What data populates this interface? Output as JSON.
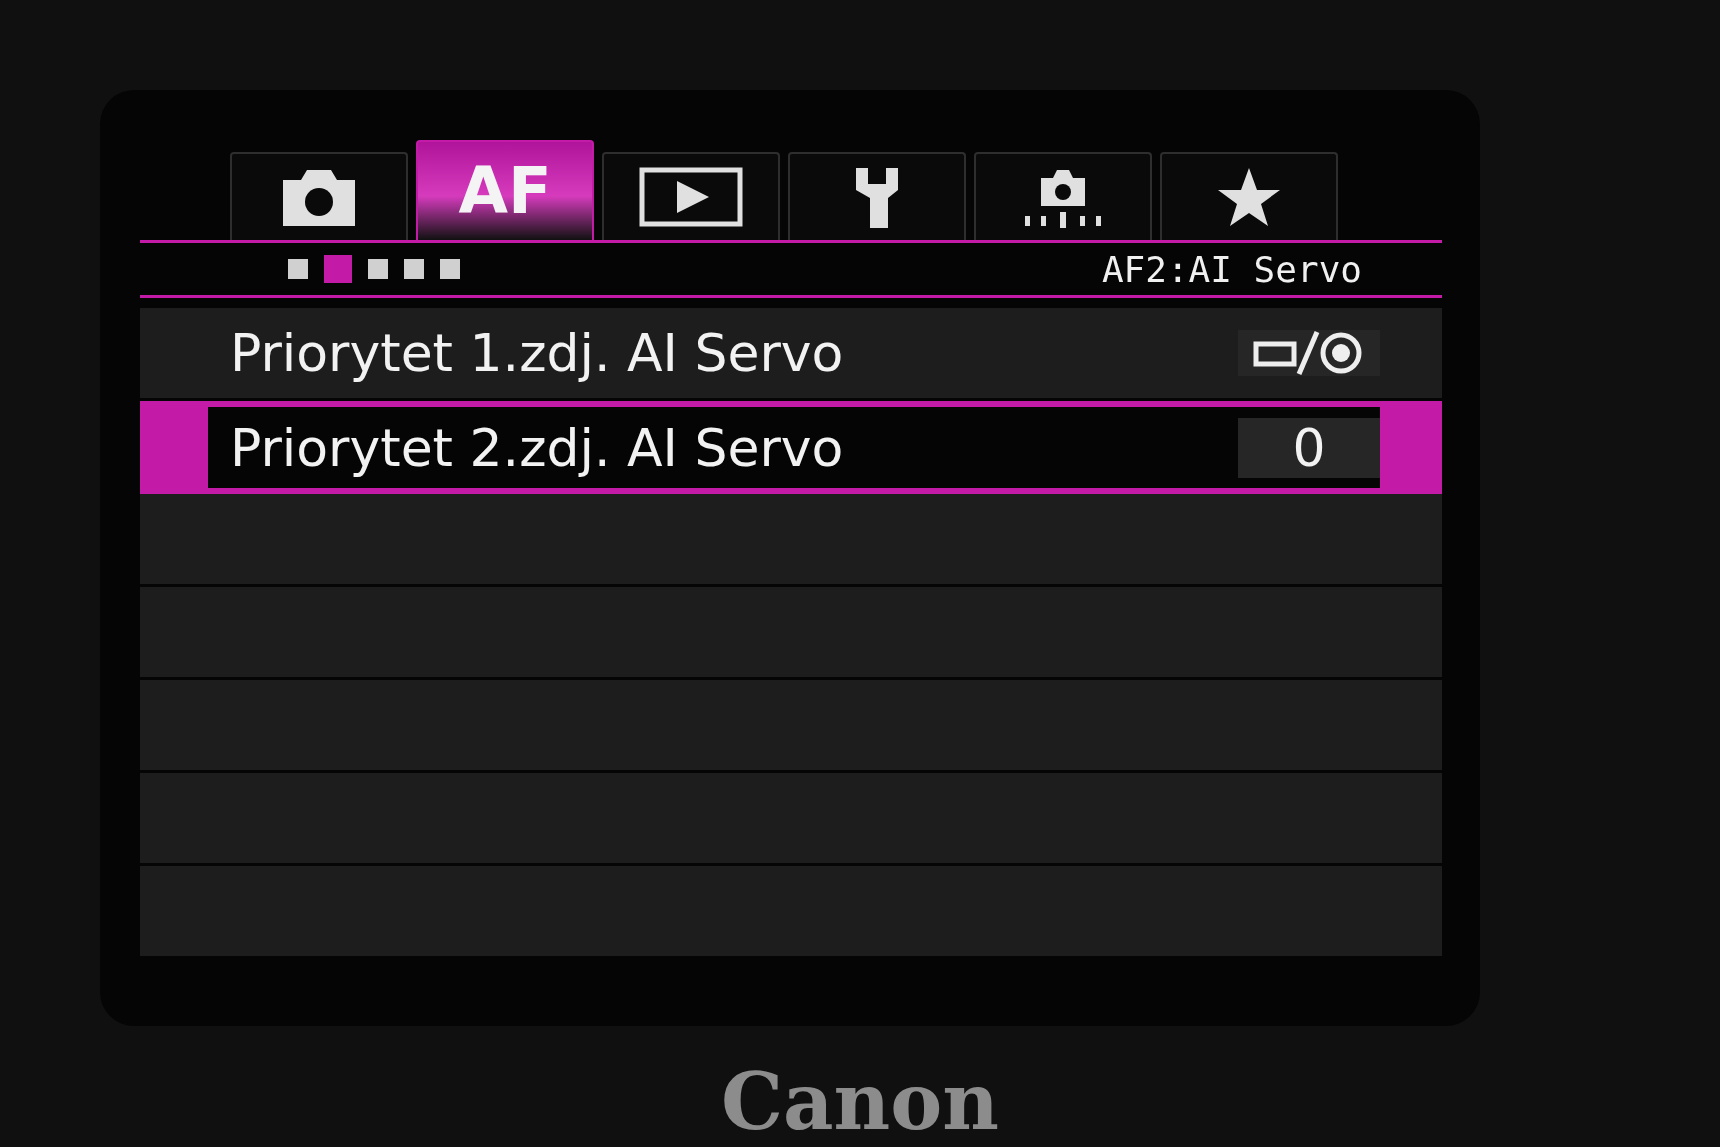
{
  "tabs": [
    {
      "kind": "camera",
      "selected": false
    },
    {
      "kind": "text",
      "label": "AF",
      "selected": true
    },
    {
      "kind": "play",
      "selected": false
    },
    {
      "kind": "wrench",
      "selected": false
    },
    {
      "kind": "custom",
      "selected": false
    },
    {
      "kind": "star",
      "selected": false
    }
  ],
  "page_dots": [
    {
      "selected": false
    },
    {
      "selected": true
    },
    {
      "selected": false
    },
    {
      "selected": false
    },
    {
      "selected": false
    }
  ],
  "page_title": "AF2:AI Servo",
  "items": [
    {
      "label": "Priorytet 1.zdj. AI Servo",
      "kind": "icon",
      "selected": false
    },
    {
      "label": "Priorytet 2.zdj. AI Servo",
      "kind": "text",
      "value": "0",
      "selected": true
    }
  ],
  "camera_body": {
    "logo": "Canon"
  }
}
